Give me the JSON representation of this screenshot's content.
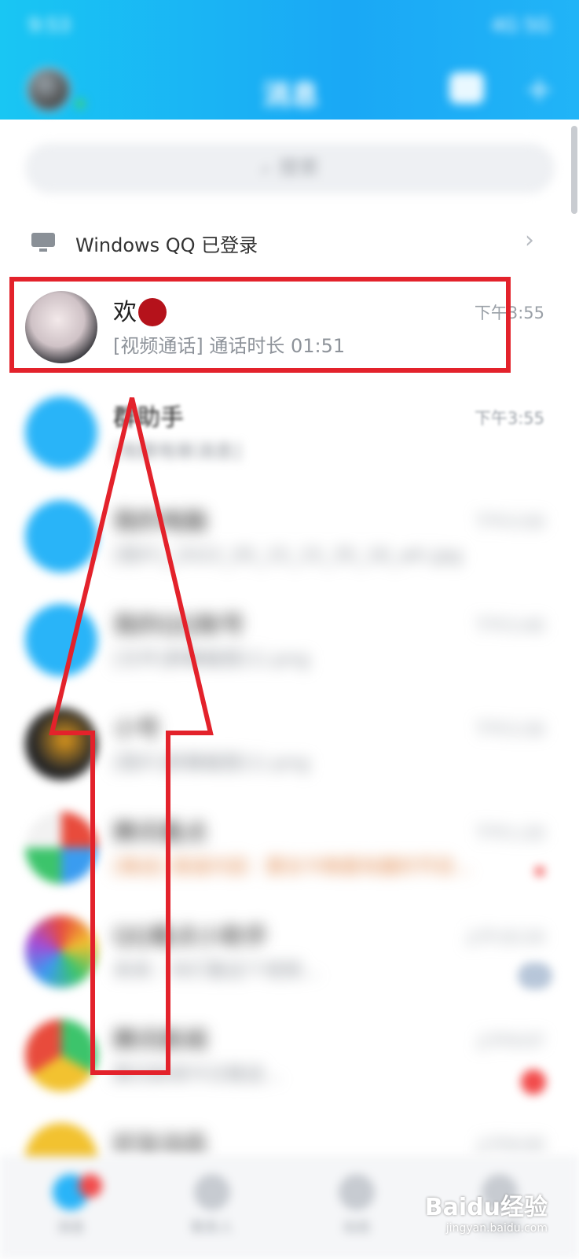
{
  "status_bar": {
    "time": "9:53",
    "indicators": "4G 5G"
  },
  "header": {
    "title": "消息"
  },
  "search": {
    "placeholder": "搜索"
  },
  "windows_login": {
    "text": "Windows QQ 已登录"
  },
  "chats": [
    {
      "name": "欢",
      "emoji": "red-demon-mask",
      "message": "[视频通话] 通话时长 01:51",
      "time": "下午3:55"
    },
    {
      "name": "群助手",
      "message": "[有群有新消息]",
      "time": "下午3:55"
    },
    {
      "name": "我的电脑",
      "message": "[图片]_2022_05_15_15_35_16_wh.jpg",
      "time": "下午3:50"
    },
    {
      "name": "我的QQ账号",
      "message": "[文件]屏幕截图(1).png",
      "time": "下午3:40"
    },
    {
      "name": "小号",
      "message": "[图片]屏幕截图(1).png",
      "time": "下午3:30"
    },
    {
      "name": "腾讯看点",
      "message": "[推送] 报道内容：要去今晚看有趣的节目...",
      "time": "下午1:20"
    },
    {
      "name": "QQ看点小助手",
      "message": "来来：你们看这个视频...",
      "time": "上午10:24"
    },
    {
      "name": "腾讯新闻",
      "message": "腾讯新闻今日推送...",
      "time": "上午9:07"
    },
    {
      "name": "好友动态",
      "message": "",
      "time": "上午8:00"
    }
  ],
  "tabs": [
    {
      "label": "消息"
    },
    {
      "label": "联系人"
    },
    {
      "label": "动态"
    },
    {
      "label": "小世界"
    }
  ],
  "watermark": {
    "brand": "Baidu经验",
    "url": "jingyan.baidu.com"
  },
  "colors": {
    "header": "#19c6f3",
    "highlight": "#e3222b",
    "badge": "#f24b4b"
  }
}
